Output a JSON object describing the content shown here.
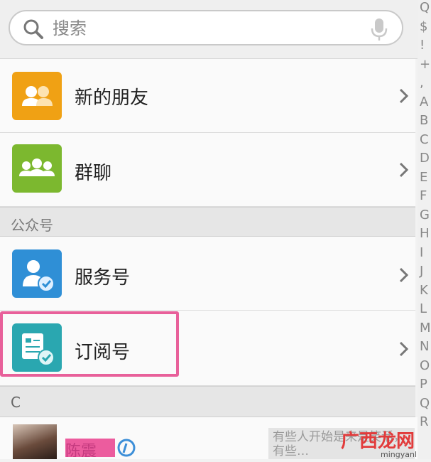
{
  "search": {
    "placeholder": "搜索"
  },
  "rows": {
    "new_friends": {
      "label": "新的朋友",
      "icon": "new-friends-icon"
    },
    "group_chat": {
      "label": "群聊",
      "icon": "group-chat-icon"
    },
    "service_account": {
      "label": "服务号",
      "icon": "service-account-icon"
    },
    "subscription_account": {
      "label": "订阅号",
      "icon": "subscription-account-icon"
    }
  },
  "sections": {
    "official_accounts": "公众号",
    "c": "C"
  },
  "contact": {
    "name": "陈震",
    "snippet": "有些人开始是来是笑话，有些…"
  },
  "watermark": {
    "brand": "广西龙网",
    "url": "mingyanl.com"
  },
  "index": [
    "Q",
    "$",
    "!",
    "+",
    ",",
    "A",
    "B",
    "C",
    "D",
    "E",
    "F",
    "G",
    "H",
    "I",
    "J",
    "K",
    "L",
    "M",
    "N",
    "O",
    "P",
    "Q",
    "R"
  ],
  "colors": {
    "new_friends_tile": "#f0a114",
    "group_chat_tile": "#7cb82f",
    "service_tile": "#2f8fd6",
    "subscription_tile": "#2aa7b0",
    "highlight": "#e8609a"
  }
}
